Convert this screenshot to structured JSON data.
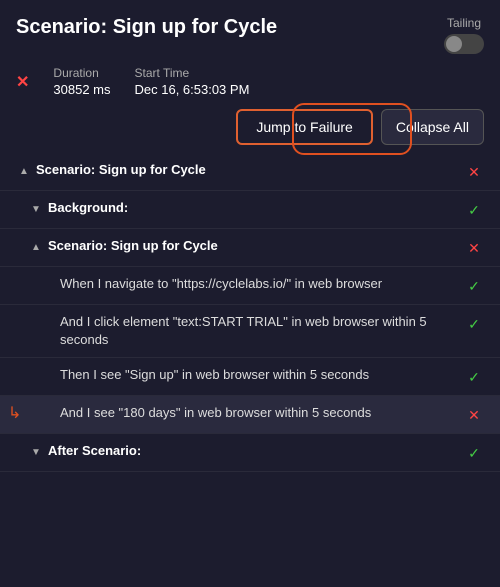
{
  "header": {
    "title": "Scenario: Sign up for Cycle",
    "tailing_label": "Tailing"
  },
  "meta": {
    "duration_label": "Duration",
    "duration_value": "30852 ms",
    "start_time_label": "Start Time",
    "start_time_value": "Dec 16, 6:53:03 PM"
  },
  "actions": {
    "jump_to_failure": "Jump to Failure",
    "collapse_all": "Collapse All"
  },
  "tree_items": [
    {
      "id": 1,
      "indent": 0,
      "expand": "▲",
      "text": "Scenario: Sign up for Cycle",
      "bold": true,
      "status": "fail"
    },
    {
      "id": 2,
      "indent": 1,
      "expand": "▼",
      "text": "Background:",
      "bold": true,
      "status": "pass"
    },
    {
      "id": 3,
      "indent": 1,
      "expand": "▲",
      "text": "Scenario: Sign up for Cycle",
      "bold": true,
      "status": "fail"
    },
    {
      "id": 4,
      "indent": 2,
      "expand": "",
      "text": "When I navigate to \"https://cyclelabs.io/\" in web browser",
      "bold": false,
      "status": "pass"
    },
    {
      "id": 5,
      "indent": 2,
      "expand": "",
      "text": "And I click element \"text:START TRIAL\" in web browser within 5 seconds",
      "bold": false,
      "status": "pass"
    },
    {
      "id": 6,
      "indent": 2,
      "expand": "",
      "text": "Then I see \"Sign up\" in web browser within 5 seconds",
      "bold": false,
      "status": "pass"
    },
    {
      "id": 7,
      "indent": 2,
      "expand": "",
      "text": "And I see \"180 days\" in web browser within 5 seconds",
      "bold": false,
      "status": "fail",
      "highlighted": true
    },
    {
      "id": 8,
      "indent": 1,
      "expand": "▼",
      "text": "After Scenario:",
      "bold": true,
      "status": "pass"
    }
  ]
}
